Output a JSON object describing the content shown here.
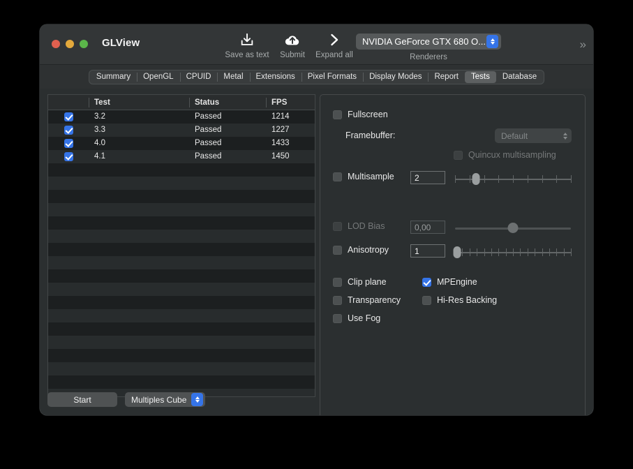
{
  "window": {
    "title": "GLView",
    "traffic_lights": [
      {
        "name": "close",
        "color": "#e0604f"
      },
      {
        "name": "minimize",
        "color": "#e3a93c"
      },
      {
        "name": "zoom",
        "color": "#5bb64a"
      }
    ]
  },
  "toolbar": {
    "items": [
      {
        "label": "Save as text",
        "icon": "download-icon"
      },
      {
        "label": "Submit",
        "icon": "cloud-upload-icon"
      },
      {
        "label": "Expand all",
        "icon": "chevron-right-icon"
      }
    ],
    "renderer": {
      "value": "NVIDIA GeForce GTX 680 O...",
      "caption": "Renderers"
    },
    "overflow_label": "»"
  },
  "tabs": [
    {
      "label": "Summary",
      "selected": false
    },
    {
      "label": "OpenGL",
      "selected": false
    },
    {
      "label": "CPUID",
      "selected": false
    },
    {
      "label": "Metal",
      "selected": false
    },
    {
      "label": "Extensions",
      "selected": false
    },
    {
      "label": "Pixel Formats",
      "selected": false
    },
    {
      "label": "Display Modes",
      "selected": false
    },
    {
      "label": "Report",
      "selected": false
    },
    {
      "label": "Tests",
      "selected": true
    },
    {
      "label": "Database",
      "selected": false
    }
  ],
  "table": {
    "columns": [
      "",
      "Test",
      "Status",
      "FPS"
    ],
    "rows": [
      {
        "checked": true,
        "test": "3.2",
        "status": "Passed",
        "fps": "1214"
      },
      {
        "checked": true,
        "test": "3.3",
        "status": "Passed",
        "fps": "1227"
      },
      {
        "checked": true,
        "test": "4.0",
        "status": "Passed",
        "fps": "1433"
      },
      {
        "checked": true,
        "test": "4.1",
        "status": "Passed",
        "fps": "1450"
      }
    ],
    "empty_row_count": 18
  },
  "bottom_bar": {
    "start_label": "Start",
    "scene_popup_value": "Multiples Cube"
  },
  "options": {
    "fullscreen": {
      "label": "Fullscreen",
      "checked": false,
      "enabled": true
    },
    "framebuffer": {
      "label": "Framebuffer:",
      "value": "Default",
      "enabled": false
    },
    "quincunx": {
      "label": "Quincux multisampling",
      "checked": false,
      "enabled": false
    },
    "multisample": {
      "label": "Multisample",
      "checked": false,
      "enabled": true,
      "value": "2",
      "slider_ticks": 8,
      "slider_position_pct": 18
    },
    "lod_bias": {
      "label": "LOD Bias",
      "checked": false,
      "enabled": false,
      "value": "0,00",
      "slider_position_pct": 50
    },
    "anisotropy": {
      "label": "Anisotropy",
      "checked": false,
      "enabled": true,
      "value": "1",
      "slider_ticks": 16,
      "slider_position_pct": 2
    },
    "checkboxes": [
      {
        "label": "Clip plane",
        "checked": false
      },
      {
        "label": "MPEngine",
        "checked": true
      },
      {
        "label": "Transparency",
        "checked": false
      },
      {
        "label": "Hi-Res Backing",
        "checked": false
      },
      {
        "label": "Use Fog",
        "checked": false
      }
    ]
  },
  "colors": {
    "accent": "#3574e8",
    "window_bg": "#2b2f30",
    "titlebar_bg": "#333637",
    "table_bg": "#1c1f20",
    "row_alt": "#282c2d"
  }
}
